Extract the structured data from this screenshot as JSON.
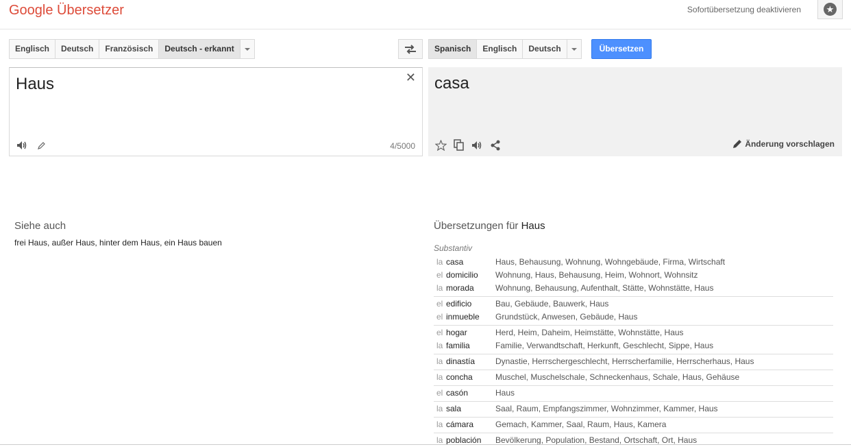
{
  "header": {
    "brand": "Google Übersetzer",
    "instant_toggle": "Sofortübersetzung deaktivieren"
  },
  "source_langs": [
    "Englisch",
    "Deutsch",
    "Französisch",
    "Deutsch - erkannt"
  ],
  "target_langs": [
    "Spanisch",
    "Englisch",
    "Deutsch"
  ],
  "translate_button": "Übersetzen",
  "source": {
    "text": "Haus",
    "counter": "4/5000"
  },
  "result": {
    "text": "casa",
    "suggest": "Änderung vorschlagen"
  },
  "see_also": {
    "title": "Siehe auch",
    "links": "frei Haus, außer Haus, hinter dem Haus, ein Haus bauen"
  },
  "dictionary": {
    "title_prefix": "Übersetzungen für",
    "title_word": "Haus",
    "pos": "Substantiv",
    "groups": [
      [
        {
          "art": "la",
          "word": "casa",
          "trans": "Haus, Behausung, Wohnung, Wohngebäude, Firma, Wirtschaft"
        },
        {
          "art": "el",
          "word": "domicilio",
          "trans": "Wohnung, Haus, Behausung, Heim, Wohnort, Wohnsitz"
        },
        {
          "art": "la",
          "word": "morada",
          "trans": "Wohnung, Behausung, Aufenthalt, Stätte, Wohnstätte, Haus"
        }
      ],
      [
        {
          "art": "el",
          "word": "edificio",
          "trans": "Bau, Gebäude, Bauwerk, Haus"
        },
        {
          "art": "el",
          "word": "inmueble",
          "trans": "Grundstück, Anwesen, Gebäude, Haus"
        }
      ],
      [
        {
          "art": "el",
          "word": "hogar",
          "trans": "Herd, Heim, Daheim, Heimstätte, Wohnstätte, Haus"
        },
        {
          "art": "la",
          "word": "familia",
          "trans": "Familie, Verwandtschaft, Herkunft, Geschlecht, Sippe, Haus"
        }
      ],
      [
        {
          "art": "la",
          "word": "dinastía",
          "trans": "Dynastie, Herrschergeschlecht, Herrscherfamilie, Herrscherhaus, Haus"
        }
      ],
      [
        {
          "art": "la",
          "word": "concha",
          "trans": "Muschel, Muschelschale, Schneckenhaus, Schale, Haus, Gehäuse"
        }
      ],
      [
        {
          "art": "el",
          "word": "casón",
          "trans": "Haus"
        }
      ],
      [
        {
          "art": "la",
          "word": "sala",
          "trans": "Saal, Raum, Empfangszimmer, Wohnzimmer, Kammer, Haus"
        }
      ],
      [
        {
          "art": "la",
          "word": "cámara",
          "trans": "Gemach, Kammer, Saal, Raum, Haus, Kamera"
        }
      ],
      [
        {
          "art": "la",
          "word": "población",
          "trans": "Bevölkerung, Population, Bestand, Ortschaft, Ort, Haus"
        }
      ]
    ]
  }
}
